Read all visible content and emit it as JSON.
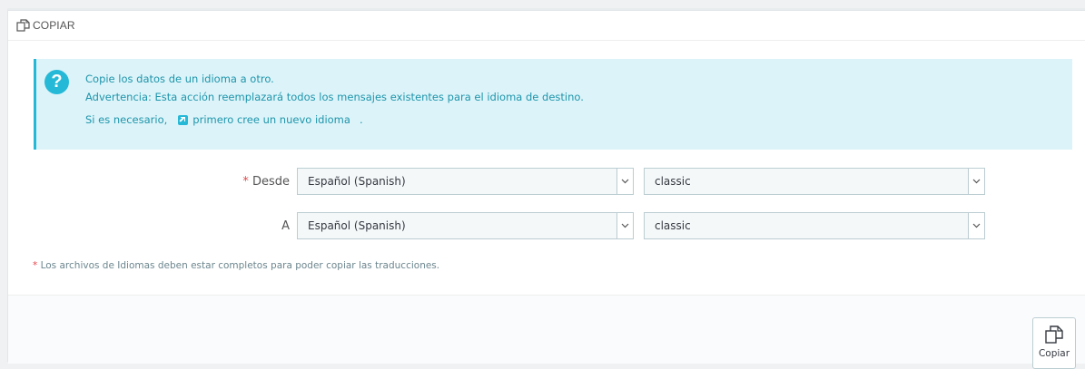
{
  "panel": {
    "title": "COPIAR",
    "title_icon": "copy-icon"
  },
  "alert": {
    "icon": "question-icon",
    "icon_glyph": "?",
    "line1": "Copie los datos de un idioma a otro.",
    "line2": "Advertencia: Esta acción reemplazará todos los mensajes existentes para el idioma de destino.",
    "line3_prefix": "Si es necesario,",
    "link_icon": "external-link-icon",
    "link_text": "primero cree un nuevo idioma",
    "line3_suffix": "."
  },
  "form": {
    "from": {
      "required_mark": "*",
      "label": "Desde",
      "language_value": "Español (Spanish)",
      "theme_value": "classic"
    },
    "to": {
      "label": "A",
      "language_value": "Español (Spanish)",
      "theme_value": "classic"
    },
    "note_mark": "*",
    "note": "Los archivos de Idiomas deben estar completos para poder copiar las traducciones."
  },
  "footer": {
    "copy_button_label": "Copiar",
    "copy_button_icon": "copy-icon"
  },
  "colors": {
    "accent": "#25b9d7",
    "alert_bg": "#dcf4f9",
    "alert_text": "#1e94ab",
    "required": "#e2474b"
  }
}
